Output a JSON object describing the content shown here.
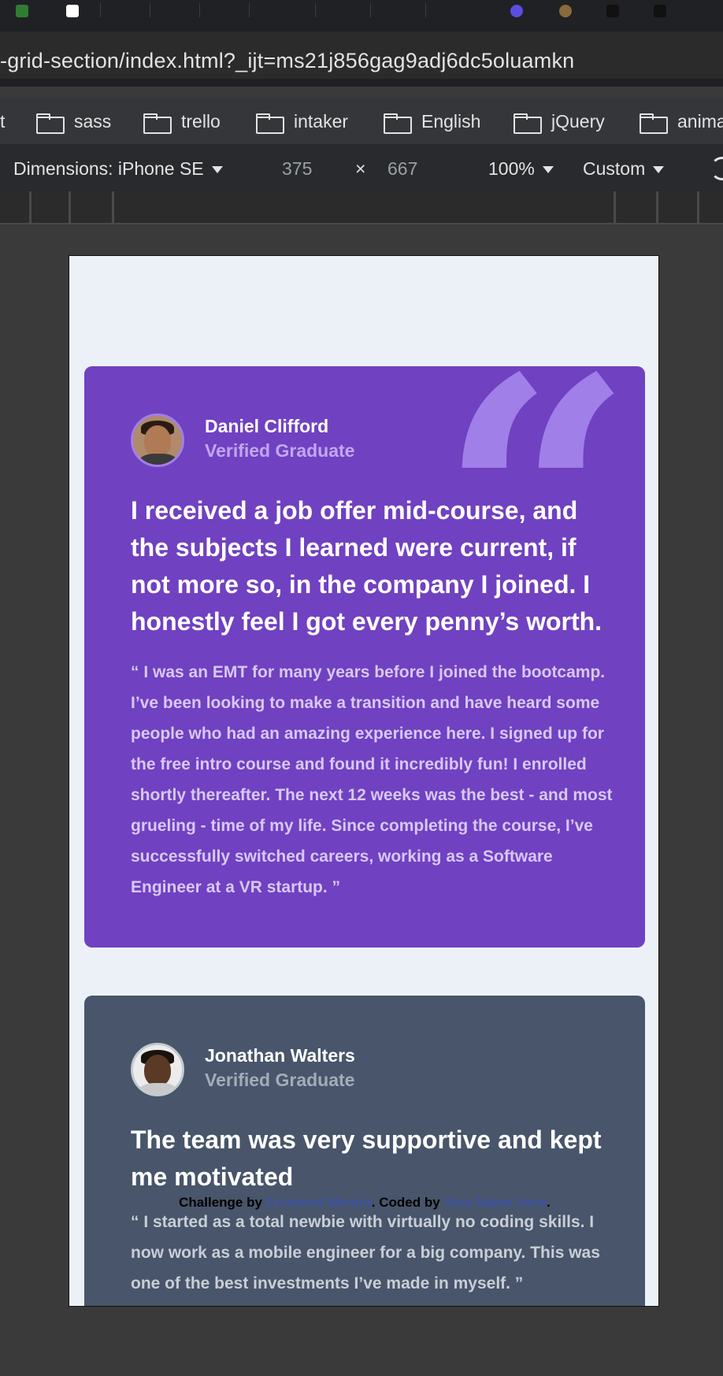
{
  "browser": {
    "url": "-grid-section/index.html?_ijt=ms21j856gag9adj6dc5oluamkn",
    "bookmarks": [
      {
        "label": "t"
      },
      {
        "label": "sass"
      },
      {
        "label": "trello"
      },
      {
        "label": "intaker"
      },
      {
        "label": "English"
      },
      {
        "label": "jQuery"
      },
      {
        "label": "anima"
      }
    ]
  },
  "devtools": {
    "dimensions_label": "Dimensions: iPhone SE",
    "width": "375",
    "times": "×",
    "height": "667",
    "zoom": "100%",
    "throttle": "Custom"
  },
  "testimonials": [
    {
      "name": "Daniel Clifford",
      "role": "Verified Graduate",
      "headline": "I received a job offer mid-course, and the subjects I learned were current, if not more so, in the company I joined. I honestly feel I got every penny’s worth.",
      "body": "“ I was an EMT for many years before I joined the bootcamp. I’ve been looking to make a transition and have heard some people who had an amazing experience here. I signed up for the free intro course and found it incredibly fun! I enrolled shortly thereafter. The next 12 weeks was the best - and most grueling - time of my life. Since completing the course, I’ve successfully switched careers, working as a Software Engineer at a VR startup. ”",
      "quote_glyph": "“"
    },
    {
      "name": "Jonathan Walters",
      "role": "Verified Graduate",
      "headline": "The team was very supportive and kept me motivated",
      "body": "“ I started as a total newbie with virtually no coding skills. I now work as a mobile engineer for a big company. This was one of the best investments I’ve made in myself. ”"
    }
  ],
  "attribution": {
    "challenge_prefix": "Challenge by ",
    "challenge_link": "Frontend Mentor",
    "coded_prefix": ". Coded by ",
    "coded_link": "Your Name Here",
    "suffix": "."
  },
  "colors": {
    "purple_card": "#7041c1",
    "slate_card": "#48556a",
    "page_bg": "#ecf1f8"
  }
}
